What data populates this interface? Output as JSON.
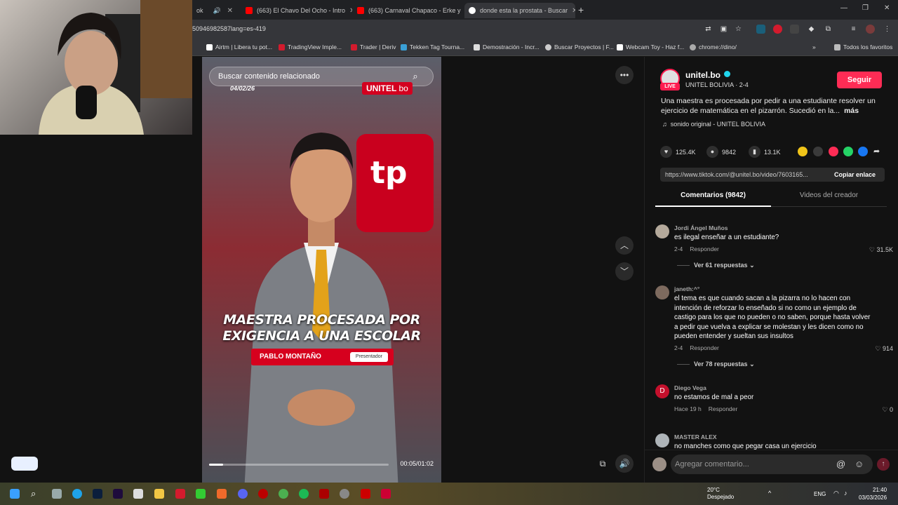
{
  "browser": {
    "tabs": [
      {
        "label": "ok"
      },
      {
        "label": "(663) El Chavo Del Ocho - Intro"
      },
      {
        "label": "(663) Carnaval Chapaco - Erke y"
      },
      {
        "label": "donde esta la prostata - Buscar"
      }
    ],
    "url": "50946982587lang=es-419",
    "bookmarks": [
      "Airtm | Libera tu pot...",
      "TradingView Imple...",
      "Trader | Deriv",
      "Tekken Tag Tourna...",
      "Demostración - Incr...",
      "Buscar Proyectos | F...",
      "Webcam Toy - Haz f...",
      "chrome://dino/"
    ],
    "all_favorites": "Todos los favoritos"
  },
  "video": {
    "search_placeholder": "Buscar contenido relacionado",
    "date": "04/02/26",
    "brand": "UNITEL",
    "brand_suffix": "bo",
    "bg_letters": "tp",
    "headline_line1": "MAESTRA PROCESADA POR",
    "headline_line2": "EXIGENCIA A UNA ESCOLAR",
    "presenter_name": "PABLO MONTAÑO",
    "presenter_role": "Presentador",
    "time": "00:05/01:02",
    "progress_fraction": 0.08
  },
  "creator": {
    "username": "unitel.bo",
    "live_badge": "LIVE",
    "subline": "UNITEL BOLIVIA · 2-4",
    "follow_label": "Seguir",
    "description": "Una maestra es procesada por pedir a una estudiante resolver un ejercicio de matemática en el pizarrón. Sucedió en la...",
    "more_label": "más",
    "sound": "sonido original - UNITEL BOLIVIA"
  },
  "stats": {
    "likes": "125.4K",
    "comments": "9842",
    "saves": "13.1K"
  },
  "link": {
    "url": "https://www.tiktok.com/@unitel.bo/video/7603165...",
    "copy_label": "Copiar enlace"
  },
  "panel_tabs": {
    "comments": "Comentarios (9842)",
    "videos": "Videos del creador"
  },
  "comments": [
    {
      "author": "Jordi Ángel Muños",
      "text": "es ilegal enseñar a un estudiante?",
      "date": "2-4",
      "reply": "Responder",
      "likes": "31.5K",
      "replies": "Ver 61 respuestas"
    },
    {
      "author": "janeth:^°",
      "text": "el tema es que cuando sacan a la pizarra no lo hacen con intención de reforzar lo enseñado si no como un ejemplo de castigo para los que no pueden o no saben, porque hasta volver a pedir que vuelva a explicar se molestan y les dicen como no pueden entender y sueltan sus insultos",
      "date": "2-4",
      "reply": "Responder",
      "likes": "914",
      "replies": "Ver 78 respuestas"
    },
    {
      "author": "Diego Vega",
      "avatar_letter": "D",
      "text": "no estamos de mal a peor",
      "date": "Hace 19 h",
      "reply": "Responder",
      "likes": "0"
    },
    {
      "author": "MASTER ALEX",
      "text": "no manches como que pegar casa un ejercicio"
    }
  ],
  "comment_input": {
    "placeholder": "Agregar comentario..."
  },
  "taskbar": {
    "temperature": "20°C",
    "weather": "Despejado",
    "lang": "ENG",
    "time": "21:40",
    "date": "03/03/2026"
  },
  "colors": {
    "accent": "#fe2c55",
    "brand_red": "#d6001e",
    "verified": "#20d5ec"
  }
}
